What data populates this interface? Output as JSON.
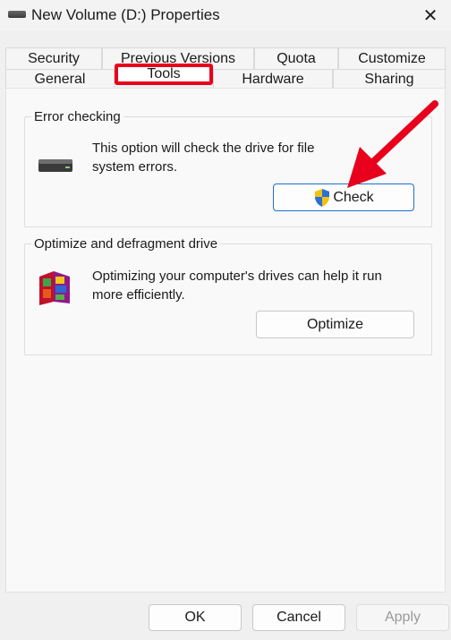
{
  "window": {
    "title": "New Volume (D:) Properties",
    "close_glyph": "✕"
  },
  "tabs": {
    "top_row": [
      {
        "label": "Security"
      },
      {
        "label": "Previous Versions"
      },
      {
        "label": "Quota"
      },
      {
        "label": "Customize"
      }
    ],
    "bottom_row": [
      {
        "label": "General"
      },
      {
        "label": "Tools"
      },
      {
        "label": "Hardware"
      },
      {
        "label": "Sharing"
      }
    ],
    "active": "Tools"
  },
  "error_checking": {
    "label": "Error checking",
    "description_line1": "This option will check the drive for file",
    "description_line2": "system errors.",
    "button_label": "Check",
    "icon": "drive-icon"
  },
  "optimize": {
    "label": "Optimize and defragment drive",
    "description_line1": "Optimizing your computer's drives can help it run",
    "description_line2": "more efficiently.",
    "button_label": "Optimize",
    "icon": "defrag-icon"
  },
  "footer": {
    "ok_label": "OK",
    "cancel_label": "Cancel",
    "apply_label": "Apply"
  },
  "colors": {
    "highlight": "#e8001c",
    "arrow": "#e8001c",
    "primary_border": "#1f6fd0"
  }
}
